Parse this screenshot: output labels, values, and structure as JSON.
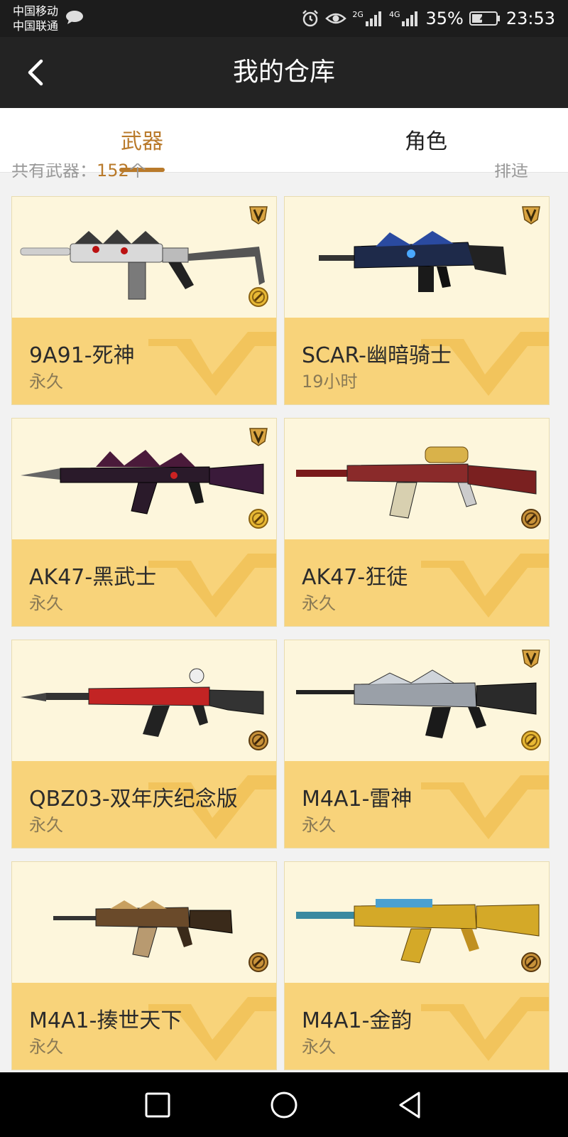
{
  "status_bar": {
    "carrier1": "中国移动",
    "carrier2": "中国联通",
    "net1": "2G",
    "net2": "4G",
    "battery": "35%",
    "time": "23:53"
  },
  "header": {
    "title": "我的仓库"
  },
  "tabs": [
    {
      "label": "武器",
      "active": true
    },
    {
      "label": "角色",
      "active": false
    }
  ],
  "summary": {
    "prefix": "共有武器：",
    "count": "152",
    "suffix": "个",
    "sort_label": "排适"
  },
  "colors": {
    "accent": "#b97a2b",
    "card_bottom": "#f8d37a",
    "card_top": "#fdf6dc"
  },
  "weapons": [
    {
      "name": "9A91-死神",
      "duration": "永久",
      "v_badge": true,
      "coin": "gold"
    },
    {
      "name": "SCAR-幽暗骑士",
      "duration": "19小时",
      "v_badge": true,
      "coin": "none"
    },
    {
      "name": "AK47-黑武士",
      "duration": "永久",
      "v_badge": true,
      "coin": "gold"
    },
    {
      "name": "AK47-狂徒",
      "duration": "永久",
      "v_badge": false,
      "coin": "bronze"
    },
    {
      "name": "QBZ03-双年庆纪念版",
      "duration": "永久",
      "v_badge": false,
      "coin": "bronze"
    },
    {
      "name": "M4A1-雷神",
      "duration": "永久",
      "v_badge": true,
      "coin": "gold"
    },
    {
      "name": "M4A1-揍世天下",
      "duration": "永久",
      "v_badge": false,
      "coin": "bronze"
    },
    {
      "name": "M4A1-金韵",
      "duration": "永久",
      "v_badge": false,
      "coin": "bronze"
    }
  ]
}
